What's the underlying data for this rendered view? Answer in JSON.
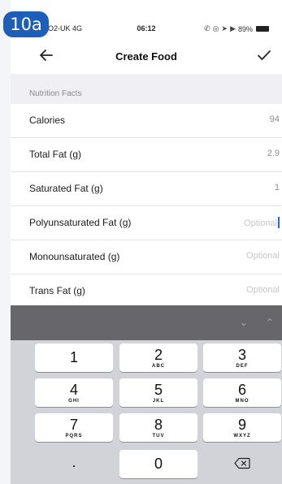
{
  "badge": "10a",
  "status": {
    "carrier": "O2-UK 4G",
    "time": "06:12",
    "battery_percent": "89%"
  },
  "nav": {
    "title": "Create Food"
  },
  "section": {
    "header": "Nutrition Facts"
  },
  "fields": [
    {
      "label": "Calories",
      "value": "94",
      "placeholder": ""
    },
    {
      "label": "Total Fat (g)",
      "value": "2.9",
      "placeholder": ""
    },
    {
      "label": "Saturated Fat (g)",
      "value": "1",
      "placeholder": ""
    },
    {
      "label": "Polyunsaturated Fat (g)",
      "value": "",
      "placeholder": "Optional"
    },
    {
      "label": "Monounsaturated (g)",
      "value": "",
      "placeholder": "Optional"
    },
    {
      "label": "Trans Fat (g)",
      "value": "",
      "placeholder": "Optional"
    }
  ],
  "keyboard": {
    "keys": [
      {
        "digit": "1",
        "letters": ""
      },
      {
        "digit": "2",
        "letters": "ABC"
      },
      {
        "digit": "3",
        "letters": "DEF"
      },
      {
        "digit": "4",
        "letters": "GHI"
      },
      {
        "digit": "5",
        "letters": "JKL"
      },
      {
        "digit": "6",
        "letters": "MNO"
      },
      {
        "digit": "7",
        "letters": "PQRS"
      },
      {
        "digit": "8",
        "letters": "TUV"
      },
      {
        "digit": "9",
        "letters": "WXYZ"
      },
      {
        "digit": ".",
        "letters": ""
      },
      {
        "digit": "0",
        "letters": ""
      }
    ]
  },
  "icons": {
    "back": "arrow-left-icon",
    "done": "checkmark-icon",
    "delete": "backspace-icon"
  },
  "colors": {
    "badge": "#1d5fb8",
    "caret": "#1e6bd6",
    "keyboard_toolbar": "#67676b",
    "keyboard_bg": "#d1d3d9"
  }
}
